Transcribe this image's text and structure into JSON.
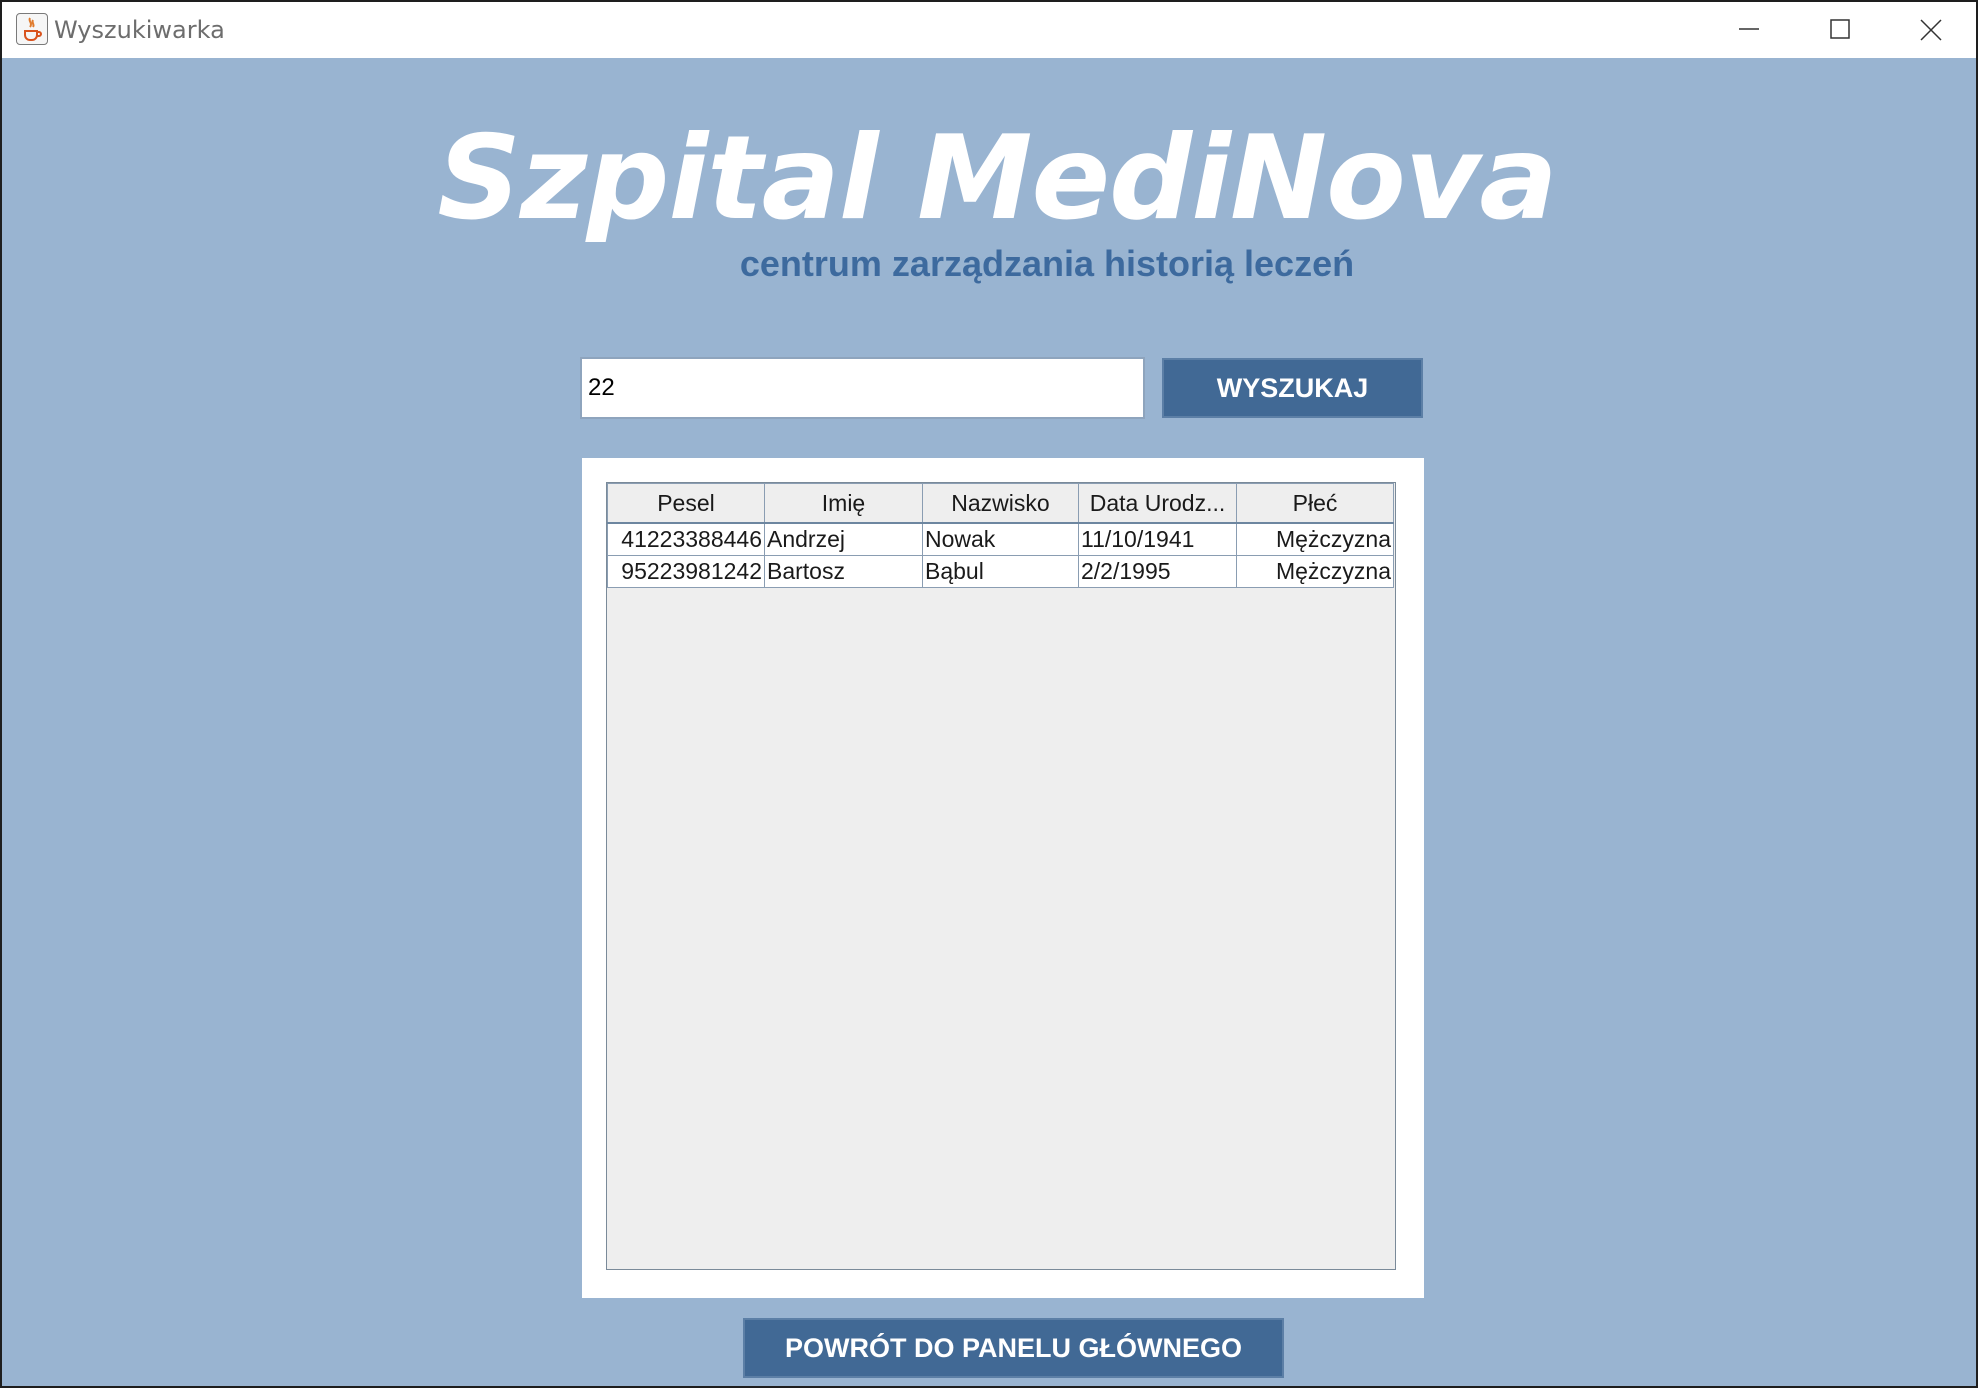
{
  "window": {
    "title": "Wyszukiwarka"
  },
  "header": {
    "headline": "Szpital MediNova",
    "subtitle": "centrum zarządzania historią leczeń"
  },
  "search": {
    "value": "22",
    "button_label": "WYSZUKAJ"
  },
  "table": {
    "columns": [
      "Pesel",
      "Imię",
      "Nazwisko",
      "Data Urodz...",
      "Płeć"
    ],
    "rows": [
      [
        "41223388446",
        "Andrzej",
        "Nowak",
        "11/10/1941",
        "Mężczyzna"
      ],
      [
        "95223981242",
        "Bartosz",
        "Bąbul",
        "2/2/1995",
        "Mężczyzna"
      ]
    ]
  },
  "footer": {
    "back_label": "POWRÓT DO PANELU GŁÓWNEGO"
  },
  "colors": {
    "background": "#99b4d1",
    "button": "#416995",
    "subtitle": "#3d6a9e"
  }
}
